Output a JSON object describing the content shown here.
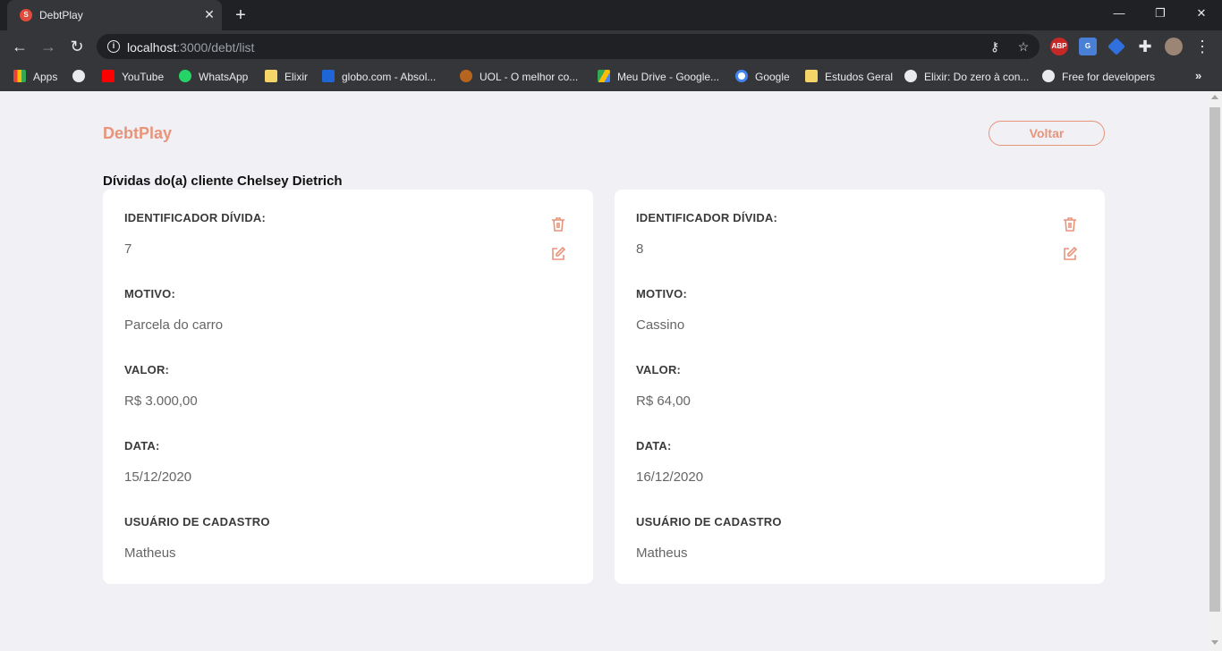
{
  "browser": {
    "tab_title": "DebtPlay",
    "tab_favicon_letter": "S",
    "url_host": "localhost",
    "url_rest": ":3000/debt/list",
    "bookmarks": [
      {
        "label": "Apps",
        "icon": "apps-grid-icon"
      },
      {
        "label": "",
        "icon": "globe-icon"
      },
      {
        "label": "YouTube",
        "icon": "youtube-icon"
      },
      {
        "label": "WhatsApp",
        "icon": "whatsapp-icon"
      },
      {
        "label": "Elixir",
        "icon": "folder-icon"
      },
      {
        "label": "globo.com - Absol...",
        "icon": "globo-icon"
      },
      {
        "label": "UOL - O melhor co...",
        "icon": "uol-icon"
      },
      {
        "label": "Meu Drive - Google...",
        "icon": "google-drive-icon"
      },
      {
        "label": "Google",
        "icon": "google-icon"
      },
      {
        "label": "Estudos Geral",
        "icon": "folder-icon"
      },
      {
        "label": "Elixir: Do zero à con...",
        "icon": "globe-icon"
      },
      {
        "label": "Free for developers",
        "icon": "globe-icon"
      }
    ],
    "extensions": [
      "ABP",
      "G",
      "",
      ""
    ]
  },
  "page": {
    "brand": "DebtPlay",
    "back_button": "Voltar",
    "heading": "Dívidas do(a) cliente Chelsey Dietrich"
  },
  "labels": {
    "id": "IDENTIFICADOR DÍVIDA:",
    "reason": "MOTIVO:",
    "value": "VALOR:",
    "date": "DATA:",
    "user": "USUÁRIO DE CADASTRO"
  },
  "debts": [
    {
      "id": "7",
      "reason": "Parcela do carro",
      "value": "R$ 3.000,00",
      "date": "15/12/2020",
      "user": "Matheus"
    },
    {
      "id": "8",
      "reason": "Cassino",
      "value": "R$ 64,00",
      "date": "16/12/2020",
      "user": "Matheus"
    }
  ],
  "colors": {
    "accent": "#e8947a",
    "page_bg": "#f0f0f5",
    "card_bg": "#ffffff"
  }
}
